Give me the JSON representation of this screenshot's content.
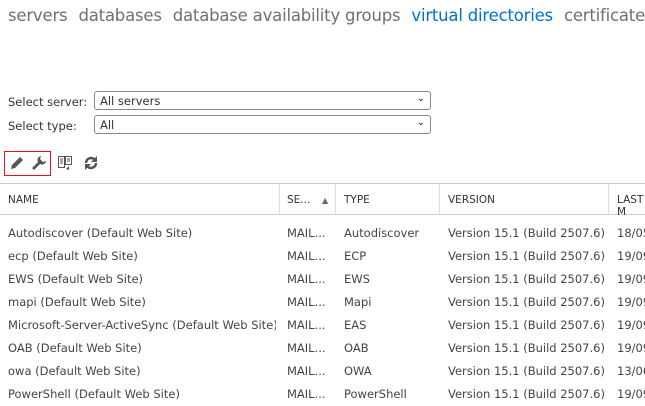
{
  "nav": {
    "tabs": [
      "servers",
      "databases",
      "database availability groups",
      "virtual directories",
      "certificates"
    ],
    "active": 3
  },
  "filters": {
    "server_label": "Select server:",
    "server_value": "All servers",
    "type_label": "Select type:",
    "type_value": "All"
  },
  "toolbar": [
    "pencil-icon",
    "wrench-icon",
    "reset-icon",
    "refresh-icon"
  ],
  "table": {
    "headers": [
      "NAME",
      "SE...",
      "TYPE",
      "VERSION",
      "LAST M"
    ],
    "rows": [
      [
        "Autodiscover (Default Web Site)",
        "MAIL...",
        "Autodiscover",
        "Version 15.1 (Build 2507.6)",
        "18/05"
      ],
      [
        "ecp (Default Web Site)",
        "MAIL...",
        "ECP",
        "Version 15.1 (Build 2507.6)",
        "19/09"
      ],
      [
        "EWS (Default Web Site)",
        "MAIL...",
        "EWS",
        "Version 15.1 (Build 2507.6)",
        "19/09"
      ],
      [
        "mapi (Default Web Site)",
        "MAIL...",
        "Mapi",
        "Version 15.1 (Build 2507.6)",
        "19/09"
      ],
      [
        "Microsoft-Server-ActiveSync (Default Web Site)",
        "MAIL...",
        "EAS",
        "Version 15.1 (Build 2507.6)",
        "19/09"
      ],
      [
        "OAB (Default Web Site)",
        "MAIL...",
        "OAB",
        "Version 15.1 (Build 2507.6)",
        "19/09"
      ],
      [
        "owa (Default Web Site)",
        "MAIL...",
        "OWA",
        "Version 15.1 (Build 2507.6)",
        "13/06"
      ],
      [
        "PowerShell (Default Web Site)",
        "MAIL...",
        "PowerShell",
        "Version 15.1 (Build 2507.6)",
        "19/09"
      ]
    ]
  }
}
